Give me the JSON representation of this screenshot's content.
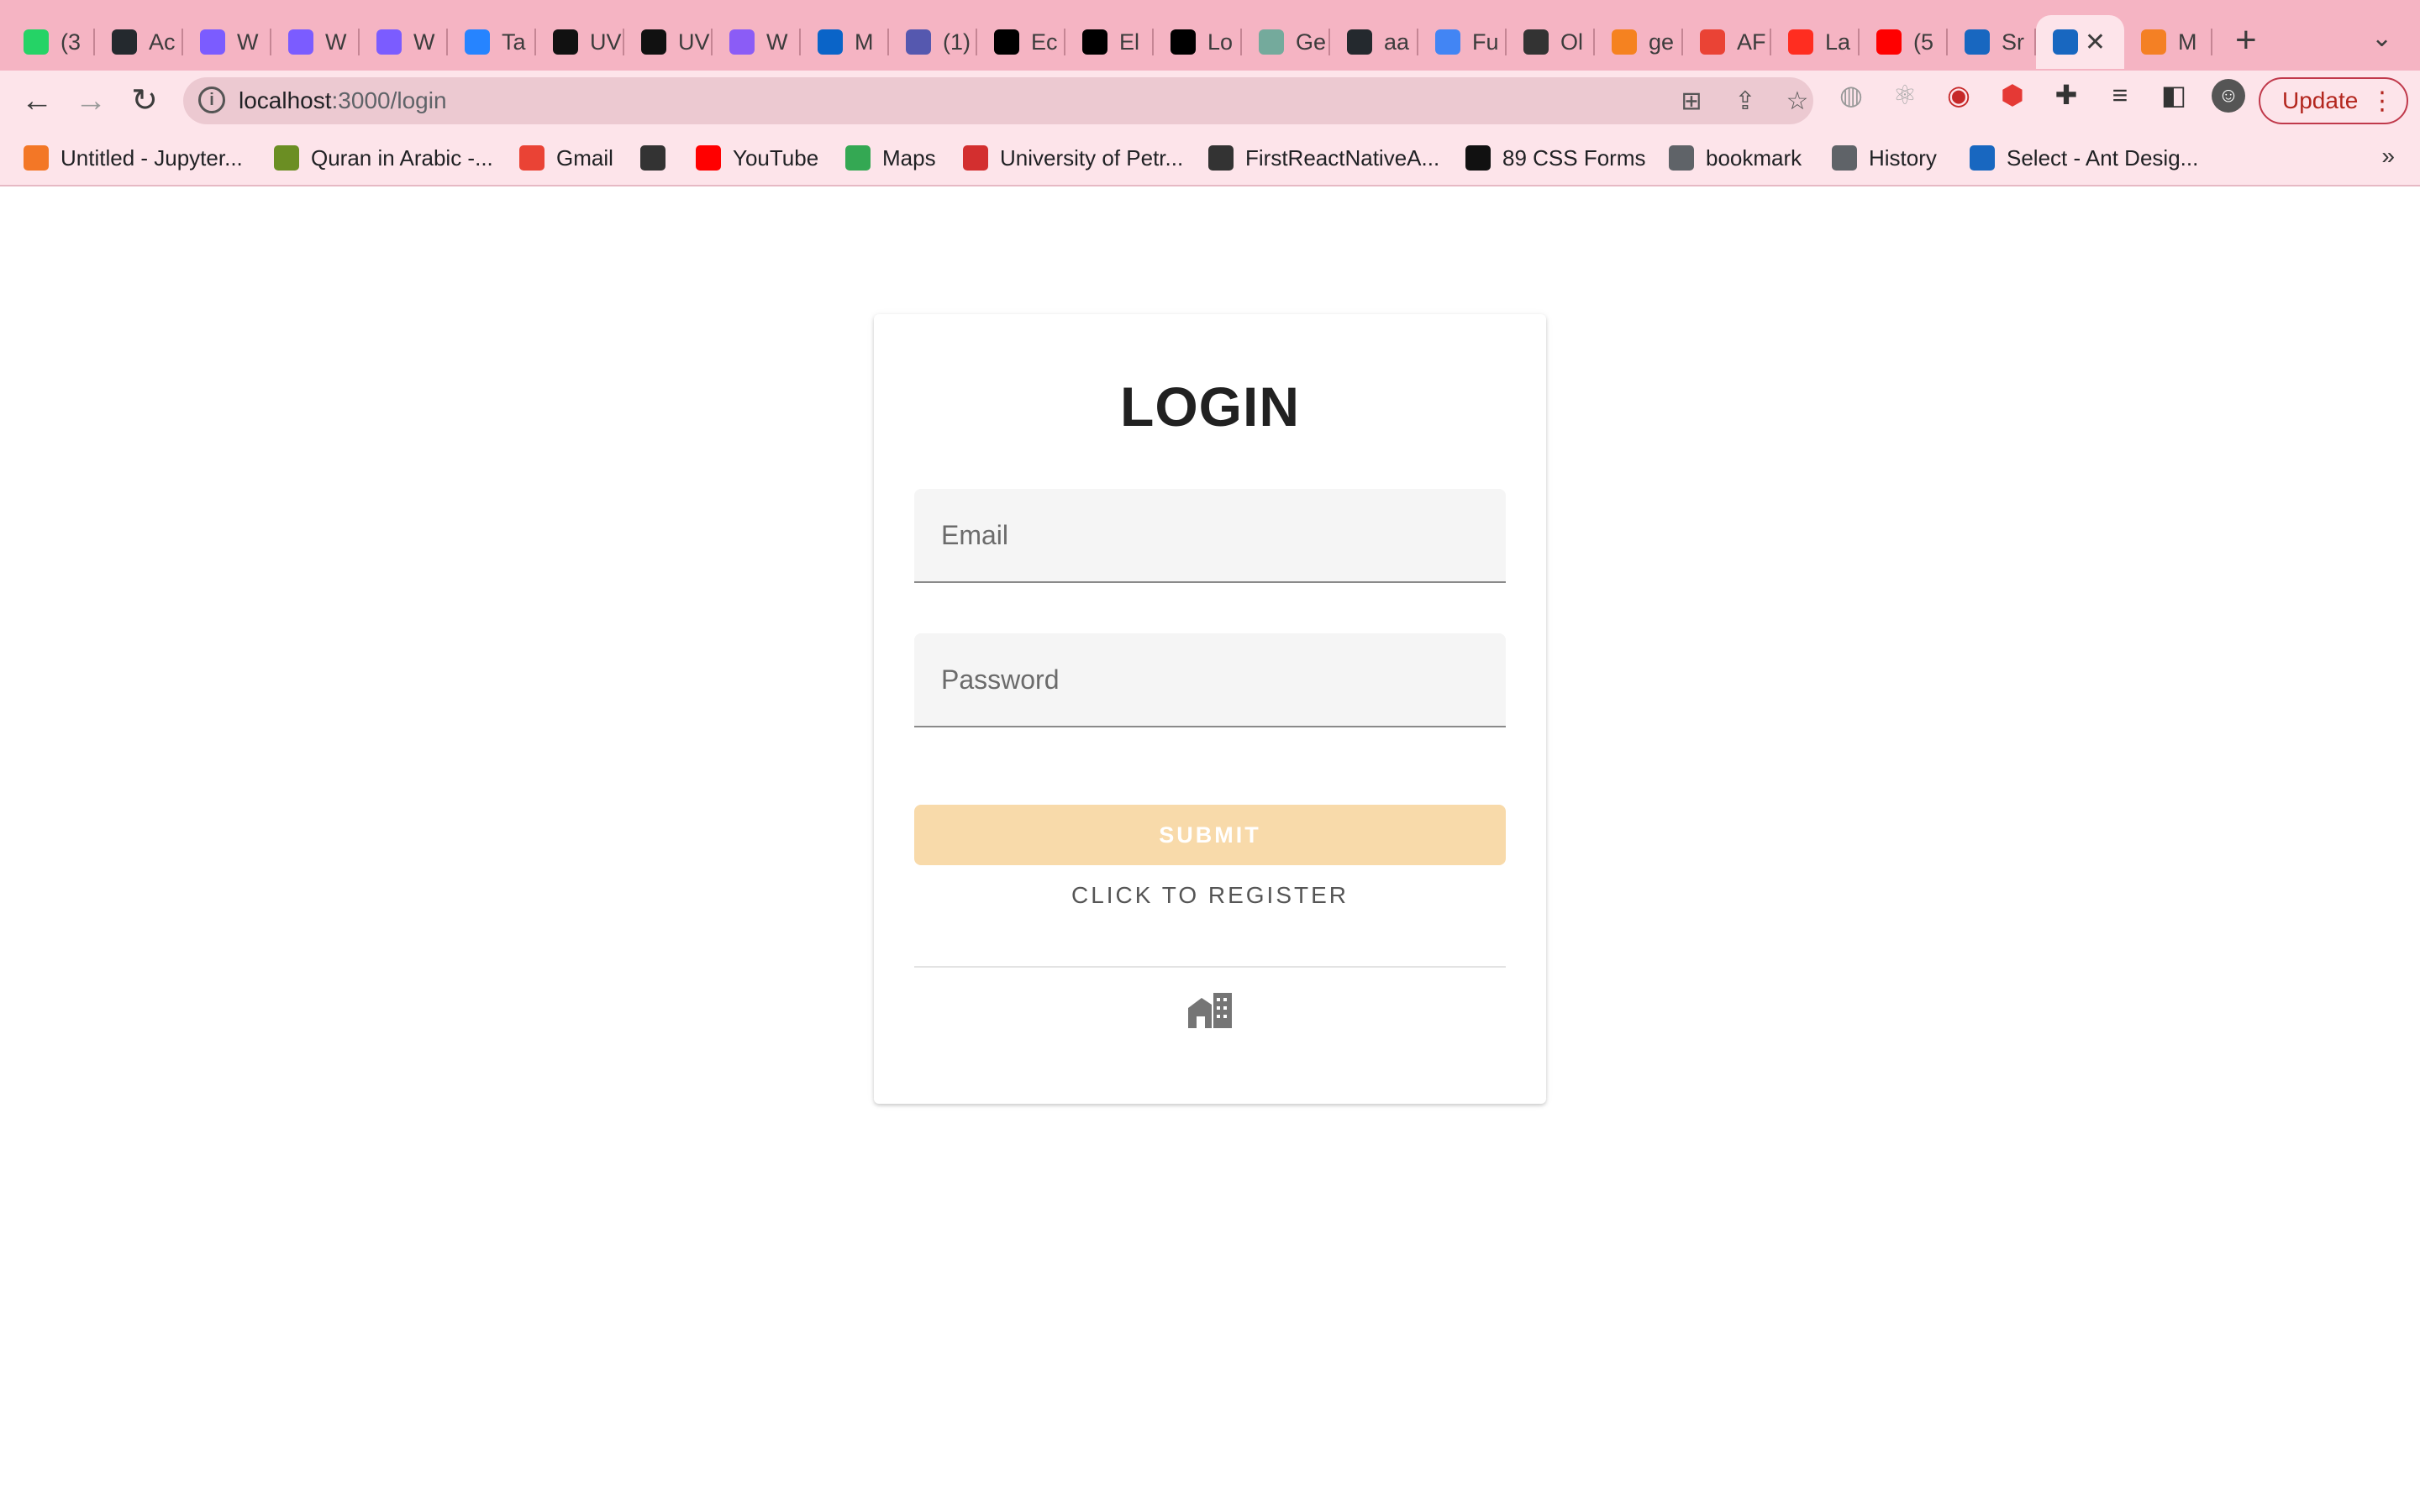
{
  "browser": {
    "tabs": [
      {
        "label": "(3",
        "icon": "whatsapp-icon",
        "color": "#25d366"
      },
      {
        "label": "Ac",
        "icon": "github-icon",
        "color": "#24292e"
      },
      {
        "label": "W",
        "icon": "webflow-icon",
        "color": "#7b5cff"
      },
      {
        "label": "W",
        "icon": "webflow-icon",
        "color": "#7b5cff"
      },
      {
        "label": "W",
        "icon": "webflow-icon",
        "color": "#7b5cff"
      },
      {
        "label": "Ta",
        "icon": "jira-icon",
        "color": "#2684ff"
      },
      {
        "label": "UV",
        "icon": "uv-icon",
        "color": "#111111"
      },
      {
        "label": "UV",
        "icon": "uv-icon",
        "color": "#111111"
      },
      {
        "label": "W",
        "icon": "copilot-icon",
        "color": "#8b5cf6"
      },
      {
        "label": "M",
        "icon": "outlook-icon",
        "color": "#0a64c8"
      },
      {
        "label": "(1)",
        "icon": "teams-icon",
        "color": "#5558af"
      },
      {
        "label": "Ec",
        "icon": "wikipedia-icon",
        "color": "#000000"
      },
      {
        "label": "El",
        "icon": "wikipedia-icon",
        "color": "#000000"
      },
      {
        "label": "Lo",
        "icon": "wikipedia-icon",
        "color": "#000000"
      },
      {
        "label": "Ge",
        "icon": "chatgpt-icon",
        "color": "#74aa9c"
      },
      {
        "label": "aa",
        "icon": "github-icon",
        "color": "#24292e"
      },
      {
        "label": "Fu",
        "icon": "docs-icon",
        "color": "#4285f4"
      },
      {
        "label": "Ol",
        "icon": "panda-icon",
        "color": "#333333"
      },
      {
        "label": "ge",
        "icon": "orange-icon",
        "color": "#f58220"
      },
      {
        "label": "AF",
        "icon": "gmail-icon",
        "color": "#ea4335"
      },
      {
        "label": "La",
        "icon": "laravel-icon",
        "color": "#ff2d20"
      },
      {
        "label": "(5",
        "icon": "youtube-icon",
        "color": "#ff0000"
      },
      {
        "label": "Sr",
        "icon": "vuetify-icon",
        "color": "#1867c0"
      },
      {
        "label": "",
        "icon": "vuetify-icon",
        "color": "#1867c0",
        "active": true
      },
      {
        "label": "M",
        "icon": "stackoverflow-icon",
        "color": "#f48024"
      }
    ],
    "new_tab": "+",
    "url_host": "localhost",
    "url_path": ":3000/login",
    "update_label": "Update",
    "bookmarks": [
      {
        "label": "Untitled - Jupyter...",
        "icon": "jupyter-icon",
        "color": "#f37726"
      },
      {
        "label": "Quran in Arabic -...",
        "icon": "quran-icon",
        "color": "#6b8e23"
      },
      {
        "label": "Gmail",
        "icon": "gmail-icon",
        "color": "#ea4335"
      },
      {
        "label": "",
        "icon": "globe-icon",
        "color": "#333333"
      },
      {
        "label": "YouTube",
        "icon": "youtube-icon",
        "color": "#ff0000"
      },
      {
        "label": "Maps",
        "icon": "maps-icon",
        "color": "#34a853"
      },
      {
        "label": "University of Petr...",
        "icon": "university-icon",
        "color": "#d32f2f"
      },
      {
        "label": "FirstReactNativeA...",
        "icon": "expo-icon",
        "color": "#333333"
      },
      {
        "label": "89 CSS Forms",
        "icon": "f-icon",
        "color": "#111111"
      },
      {
        "label": "bookmark",
        "icon": "folder-icon",
        "color": "#5f6368"
      },
      {
        "label": "History",
        "icon": "history-icon",
        "color": "#5f6368"
      },
      {
        "label": "Select - Ant Desig...",
        "icon": "vuetify-icon",
        "color": "#1867c0"
      }
    ]
  },
  "login": {
    "title": "LOGIN",
    "email_placeholder": "Email",
    "password_placeholder": "Password",
    "submit_label": "SUBMIT",
    "register_label": "CLICK TO REGISTER",
    "submit_color": "#f8daaa"
  }
}
